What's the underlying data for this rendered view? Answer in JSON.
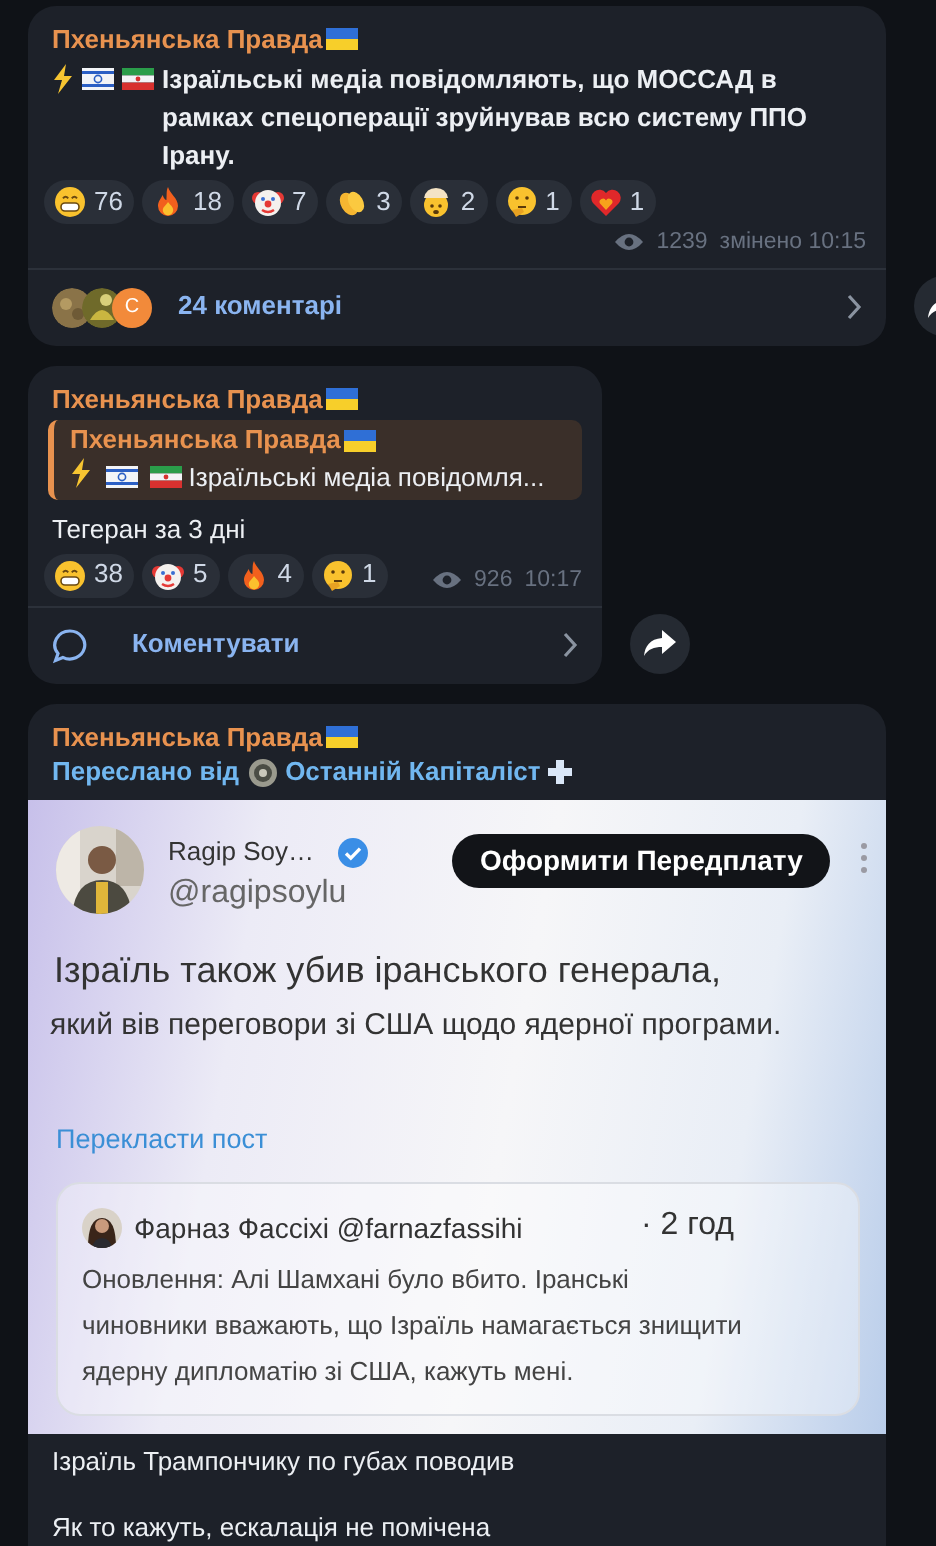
{
  "messages": [
    {
      "kind": "announcement",
      "channel": "Пхеньянська Правда",
      "text": "Ізраїльські медіа повідомляють, що МОССАД в рамках спецоперації зруйнував всю систему ППО Ірану.",
      "reactions": [
        {
          "kind": "grin",
          "count": "76"
        },
        {
          "kind": "fire",
          "count": "18"
        },
        {
          "kind": "clown",
          "count": "7"
        },
        {
          "kind": "clap",
          "count": "3"
        },
        {
          "kind": "exploding",
          "count": "2"
        },
        {
          "kind": "thinking",
          "count": "1"
        },
        {
          "kind": "heartfire",
          "count": "1"
        }
      ],
      "views": "1239",
      "time": "змінено 10:15",
      "comments": {
        "avatar_letter": "С",
        "label": "24 коментарі"
      }
    },
    {
      "kind": "reply",
      "channel": "Пхеньянська Правда",
      "reply": {
        "channel": "Пхеньянська Правда",
        "text": "Ізраїльські медіа повідомля..."
      },
      "text": "Тегеран за 3 дні",
      "reactions": [
        {
          "kind": "grin",
          "count": "38"
        },
        {
          "kind": "clown",
          "count": "5"
        },
        {
          "kind": "fire",
          "count": "4"
        },
        {
          "kind": "thinking",
          "count": "1"
        }
      ],
      "views": "926",
      "time": "10:17",
      "comment_button": "Коментувати"
    },
    {
      "kind": "forward",
      "channel": "Пхеньянська Правда",
      "forwarded_label": "Переслано від",
      "forwarded_from": "Останній Капіталіст",
      "tweet": {
        "author": "Ragip Soy…",
        "handle": "@ragipsoylu",
        "subscribe_button": "Оформити Передплату",
        "text_lines": [
          "Ізраїль також убив іранського генерала,",
          "який вів переговори зі США щодо ядерної програми."
        ],
        "translate_link": "Перекласти пост",
        "quote": {
          "author": "Фарназ Фассіхі @farnazfassihi",
          "time": "· 2 год",
          "text": "Оновлення: Алі Шамхані було вбито. Іранські чиновники вважають, що Ізраїль намагається знищити ядерну дипломатію зі США, кажуть мені."
        }
      },
      "captions": [
        "Ізраїль Трампончику по губах поводив",
        "Як то кажуть, ескалація не помічена"
      ]
    }
  ]
}
